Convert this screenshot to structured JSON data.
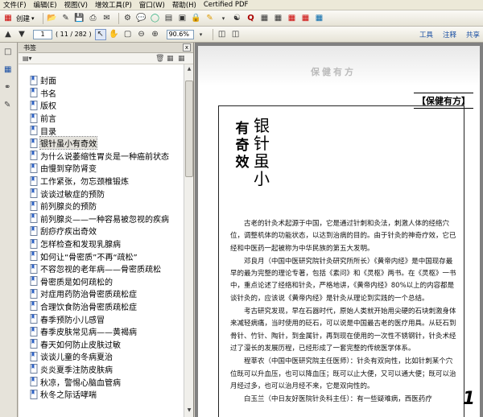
{
  "menu": [
    "文件(F)",
    "编辑(E)",
    "视图(V)",
    "增效工具(P)",
    "窗口(W)",
    "帮助(H)",
    "Certified PDF"
  ],
  "toolbar": {
    "create_label": "创建",
    "page_current": "1",
    "page_count": "( 11 / 282 )",
    "zoom_value": "90.6%",
    "links": [
      "工具",
      "注释",
      "共享"
    ]
  },
  "panel": {
    "title": "书签",
    "close_glyph": "x"
  },
  "bookmarks": [
    "封面",
    "书名",
    "版权",
    "前言",
    "目录",
    "银针虽小有奇效",
    "为什么说萎缩性胃炎是一种癌前状态",
    "由慢到穿防肾变",
    "工作紧张，勿忘颈椎锻炼",
    "谈谈过敏症的预防",
    "前列腺炎的预防",
    "前列腺炎——一种容易被忽视的疾病",
    "刮痧疗疾出奇效",
    "怎样检查和发现乳腺病",
    "如何让“骨密质”不再“疏松”",
    "不容忽视的老年病——骨密质疏松",
    "骨密质是如何疏松的",
    "对症用药防治骨密质疏松症",
    "合理饮食防治骨密质疏松症",
    "春季预防小儿感冒",
    "春季皮肤常见病——黄褐病",
    "春天如何防止皮肤过敏",
    "谈谈儿童的冬病夏治",
    "炎炎夏季注防皮肤病",
    "秋凉，警惕心脑血管病",
    "秋冬之际话哮喘"
  ],
  "selected_index": 5,
  "document": {
    "ghost_header": "保健有方",
    "section_label": "【保健有方】",
    "title_left": [
      "有",
      "奇",
      "效"
    ],
    "title_right": [
      "银",
      "针",
      "虽",
      "小"
    ],
    "paragraphs": [
      "古老的针灸术起源于中国，它是通过针刺和灸法，刺激人体的经络穴位，调整机体的功能状态，以达到治病的目的。由于针灸的神奇疗效，它已经和中医药一起被称为中华民族的第五大发明。",
      "邓良月（中国中医研究院针灸研究所所长）《黄帝内经》是中国现存最早的最为完整的理论专著，包括《素问》和《灵枢》两书。在《灵枢》一书中，重点论述了经络和针灸，严格地讲，《黄帝内经》80%以上的内容都是谈针灸的，应该说《黄帝内经》是针灸从理论到实践的一个总结。",
      "考古研究发现，早在石器时代，原始人类就开始用尖硬的石块刺激身体来减轻病痛，当时使用的砭石，可以说是中国最古老的医疗用具。从砭石到骨针、竹针、陶针，到金属针，再到现在使用的一次性不锈钢针，针灸术经过了漫长的发展历程，已经形成了一套完整的传统医学体系。",
      "程莘农（中国中医研究院主任医师）：针灸有双向性，比如针刺某个穴位既可以升血压，也可以降血压；既可以止大便，又可以通大便；既可以治月经过多，也可以治月经不来，它是双向性的。",
      "白玉兰（中日友好医院针灸科主任）：有一些疑难病，西医药疗"
    ],
    "page_number": "1"
  }
}
